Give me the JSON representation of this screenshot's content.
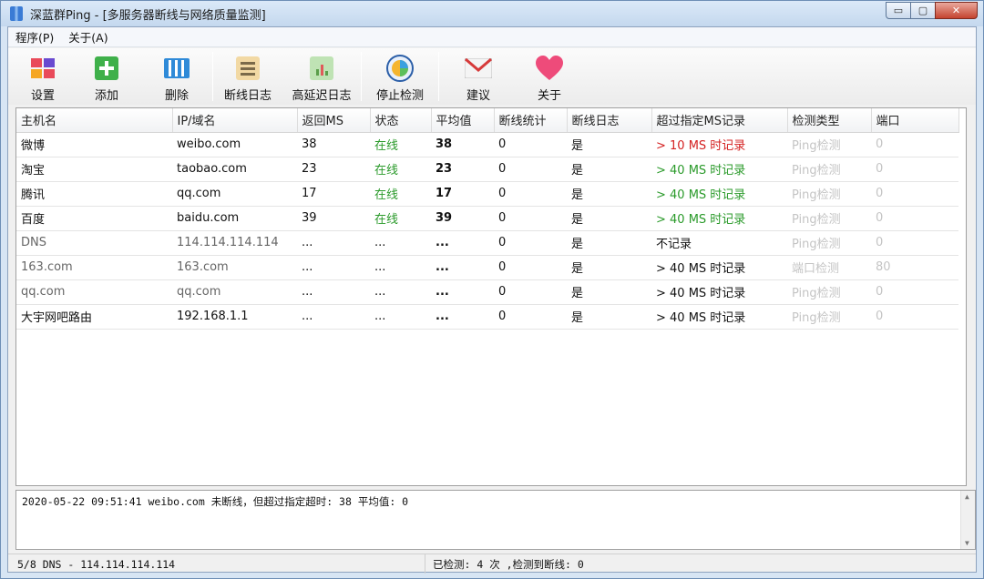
{
  "window": {
    "title": "深蓝群Ping - [多服务器断线与网络质量监测]",
    "min_symbol": "▭",
    "max_symbol": "▢",
    "close_symbol": "✕"
  },
  "menu": [
    "程序(P)",
    "关于(A)"
  ],
  "toolbar": {
    "settings": "设置",
    "add": "添加",
    "delete": "删除",
    "disconnect_log": "断线日志",
    "high_latency_log": "高延迟日志",
    "stop_detect": "停止检测",
    "suggest": "建议",
    "about": "关于"
  },
  "table": {
    "columns": [
      "主机名",
      "IP/域名",
      "返回MS",
      "状态",
      "平均值",
      "断线统计",
      "断线日志",
      "超过指定MS记录",
      "检测类型",
      "端口"
    ],
    "rows": [
      {
        "host": "微博",
        "ip": "weibo.com",
        "ms": "38",
        "status": "在线",
        "avg": "38",
        "drops": "0",
        "log": "是",
        "over": "> 10 MS 时记录",
        "type": "Ping检测",
        "port": "0",
        "over_color": "red"
      },
      {
        "host": "淘宝",
        "ip": "taobao.com",
        "ms": "23",
        "status": "在线",
        "avg": "23",
        "drops": "0",
        "log": "是",
        "over": "> 40 MS 时记录",
        "type": "Ping检测",
        "port": "0",
        "over_color": "green"
      },
      {
        "host": "腾讯",
        "ip": "qq.com",
        "ms": "17",
        "status": "在线",
        "avg": "17",
        "drops": "0",
        "log": "是",
        "over": "> 40 MS 时记录",
        "type": "Ping检测",
        "port": "0",
        "over_color": "green"
      },
      {
        "host": "百度",
        "ip": "baidu.com",
        "ms": "39",
        "status": "在线",
        "avg": "39",
        "drops": "0",
        "log": "是",
        "over": "> 40 MS 时记录",
        "type": "Ping检测",
        "port": "0",
        "over_color": "green"
      },
      {
        "host": "DNS",
        "ip": "114.114.114.114",
        "ms": "...",
        "status": "...",
        "avg": "...",
        "drops": "0",
        "log": "是",
        "over": "不记录",
        "type": "Ping检测",
        "port": "0",
        "over_color": "plain",
        "host_gray": true
      },
      {
        "host": "163.com",
        "ip": "163.com",
        "ms": "...",
        "status": "...",
        "avg": "...",
        "drops": "0",
        "log": "是",
        "over": "> 40 MS 时记录",
        "type": "端口检测",
        "port": "80",
        "over_color": "plain",
        "host_gray": true
      },
      {
        "host": "qq.com",
        "ip": "qq.com",
        "ms": "...",
        "status": "...",
        "avg": "...",
        "drops": "0",
        "log": "是",
        "over": "> 40 MS 时记录",
        "type": "Ping检测",
        "port": "0",
        "over_color": "plain",
        "host_gray": true
      },
      {
        "host": "大宇网吧路由",
        "ip": "192.168.1.1",
        "ms": "...",
        "status": "...",
        "avg": "...",
        "drops": "0",
        "log": "是",
        "over": "> 40 MS 时记录",
        "type": "Ping检测",
        "port": "0",
        "over_color": "plain"
      }
    ]
  },
  "log": {
    "line": "2020-05-22 09:51:41 weibo.com 未断线，但超过指定超时: 38 平均值: 0"
  },
  "status": {
    "left": "5/8 DNS - 114.114.114.114",
    "right": "已检测: 4 次 ,检测到断线: 0"
  },
  "colors": {
    "online": "#2a9a2a",
    "alert": "#d42020",
    "muted": "#c4c4c4"
  }
}
